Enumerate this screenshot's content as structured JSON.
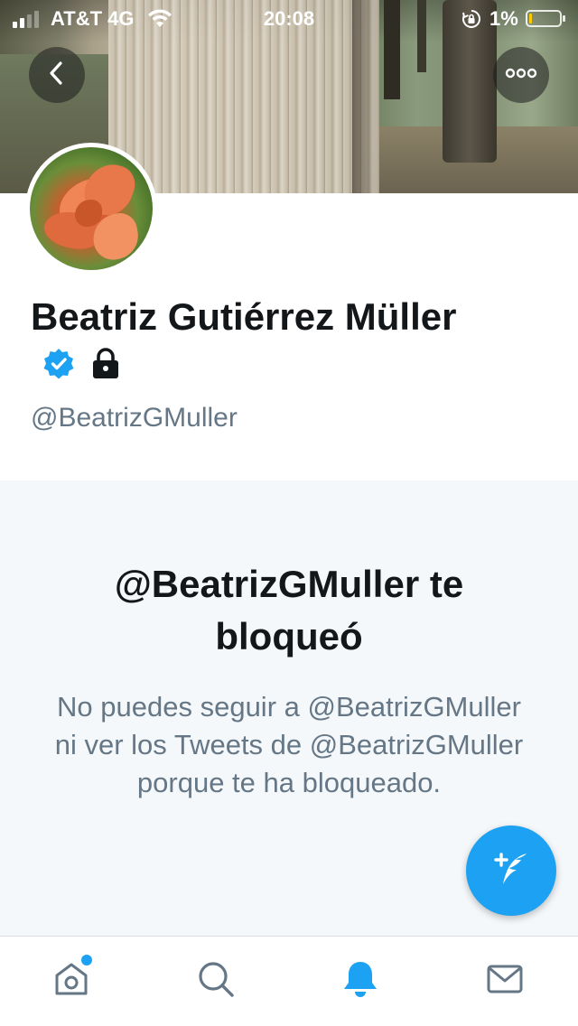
{
  "status_bar": {
    "carrier": "AT&T 4G",
    "time": "20:08",
    "battery_percent": "1%",
    "signal_bars": 2,
    "signal_bars_total": 4,
    "icons": [
      "signal-icon",
      "wifi-icon",
      "rotation-lock-icon",
      "battery-icon"
    ]
  },
  "header": {
    "back_icon": "chevron-left-icon",
    "more_icon": "more-horizontal-icon"
  },
  "profile": {
    "name": "Beatriz Gutiérrez Müller",
    "handle": "@BeatrizGMuller",
    "verified_icon": "verified-badge-icon",
    "protected_icon": "lock-icon"
  },
  "blocked": {
    "title": "@BeatrizGMuller te bloqueó",
    "description": "No puedes seguir a @BeatrizGMuller ni ver los Tweets de @BeatrizGMuller porque te ha bloqueado."
  },
  "fab": {
    "icon": "compose-tweet-icon"
  },
  "tab_bar": {
    "tabs": [
      {
        "name": "home",
        "icon": "home-icon",
        "has_dot": true
      },
      {
        "name": "search",
        "icon": "search-icon",
        "has_dot": false
      },
      {
        "name": "notifications",
        "icon": "bell-icon",
        "active": true
      },
      {
        "name": "messages",
        "icon": "mail-icon",
        "has_dot": false
      }
    ]
  },
  "colors": {
    "accent": "#1da1f2",
    "text_primary": "#14171a",
    "text_secondary": "#657786",
    "panel_bg": "#f5f8fa"
  }
}
